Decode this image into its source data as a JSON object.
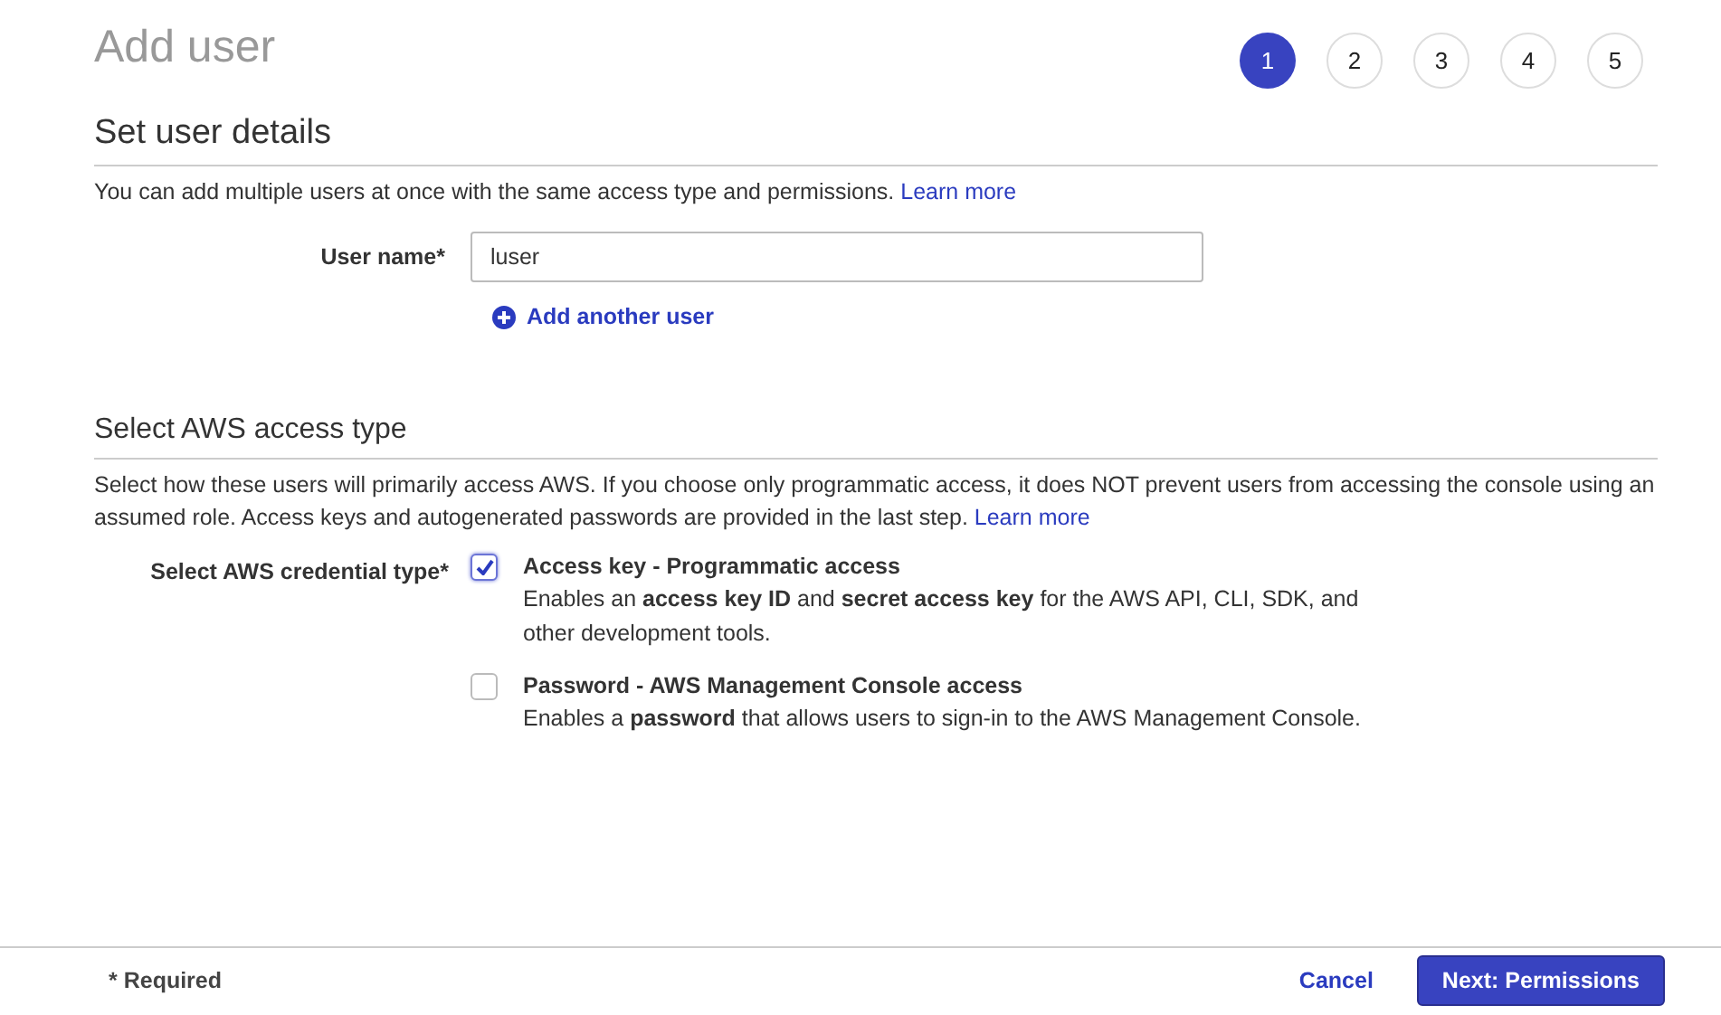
{
  "page_title": "Add user",
  "steps": [
    {
      "label": "1",
      "selected": true
    },
    {
      "label": "2",
      "selected": false
    },
    {
      "label": "3",
      "selected": false
    },
    {
      "label": "4",
      "selected": false
    },
    {
      "label": "5",
      "selected": false
    }
  ],
  "user_details": {
    "heading": "Set user details",
    "description": "You can add multiple users at once with the same access type and permissions.",
    "link": "Learn more",
    "field_label": "User name*",
    "field_value": "luser",
    "add_link": "Add another user"
  },
  "access_type": {
    "heading": "Select AWS access type",
    "description": "Select how these users will primarily access AWS. If you choose only programmatic access, it does NOT prevent users from accessing the console using an assumed role. Access keys and autogenerated passwords are provided in the last step.",
    "link": "Learn more",
    "field_label": "Select AWS credential type*",
    "options": [
      {
        "title": "Access key - Programmatic access",
        "description": "Enables an **access key ID** and **secret access key** for the AWS API, CLI, SDK, and other development tools.",
        "checked": true
      },
      {
        "title": "Password - AWS Management Console access",
        "description": "Enables a **password** that allows users to sign-in to the AWS Management Console.",
        "checked": false
      }
    ]
  },
  "footer": {
    "note": "* Required",
    "cancel": "Cancel",
    "next": "Next: Permissions"
  }
}
